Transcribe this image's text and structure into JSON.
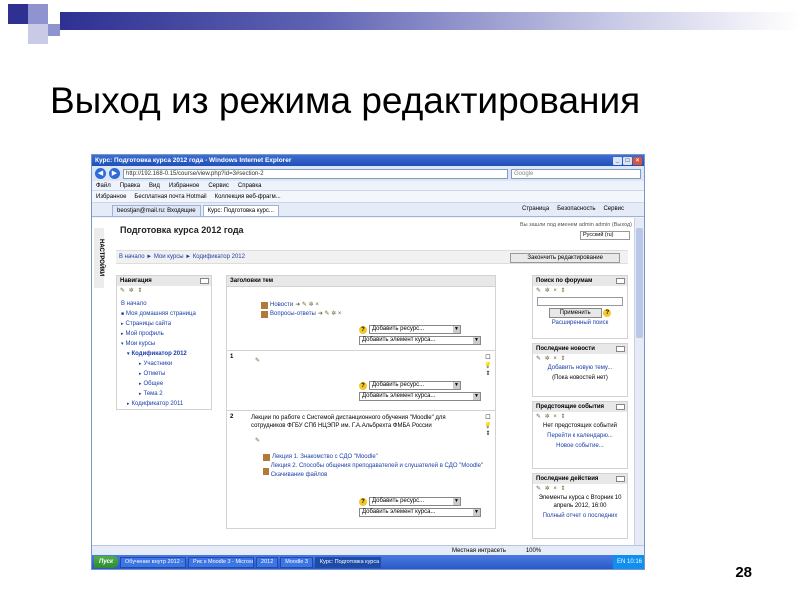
{
  "slide": {
    "title": "Выход из режима редактирования",
    "page_number": "28",
    "colors": {
      "bar_start": "#2e3192",
      "bar_end": "#ffffff"
    }
  },
  "browser": {
    "window_title": "Курс: Подготовка курса 2012 года - Windows Internet Explorer",
    "address": "http://192.168-0.15/course/view.php?id=3#section-2",
    "search_placeholder": "Google",
    "menu": [
      "Файл",
      "Правка",
      "Вид",
      "Избранное",
      "Сервис",
      "Справка"
    ],
    "favorites": [
      "Избранное",
      "Бесплатная почта Hotmail",
      "Коллекция веб-фрагм..."
    ],
    "tabs": [
      "beostjan@mail.ru: Входящие",
      "Курс: Подготовка курс..."
    ],
    "tab_tools": [
      "Страница",
      "Безопасность",
      "Сервис"
    ],
    "status_zone": "Местная интрасеть",
    "zoom": "100%"
  },
  "page": {
    "course_title": "Подготовка курса 2012 года",
    "logged_in": "Вы зашли под именем admin admin (Выход)",
    "language": "Русский (ru)",
    "breadcrumb": "В начало ► Мои курсы ► Кодификатор 2012",
    "edit_button": "Закончить редактирование",
    "left_strip": "НАСТРОЙКИ"
  },
  "navigation": {
    "title": "Навигация",
    "items": [
      {
        "label": "В начало",
        "level": 0
      },
      {
        "label": "Моя домашняя страница",
        "level": 0
      },
      {
        "label": "Страницы сайта",
        "level": 0
      },
      {
        "label": "Мой профиль",
        "level": 0
      },
      {
        "label": "Мои курсы",
        "level": 0
      },
      {
        "label": "Кодификатор 2012",
        "level": 1
      },
      {
        "label": "Участники",
        "level": 2
      },
      {
        "label": "Отметы",
        "level": 2
      },
      {
        "label": "Общее",
        "level": 2
      },
      {
        "label": "Тема 2",
        "level": 2
      },
      {
        "label": "Кодификатор 2011",
        "level": 1
      }
    ]
  },
  "sections": {
    "header": "Заголовки тем",
    "add_resource": "Добавить ресурс...",
    "add_activity": "Добавить элемент курса...",
    "section0_items": [
      "Новости",
      "Вопросы-ответы"
    ],
    "section1_num": "1",
    "section2_num": "2",
    "section2_text": "Лекции по работе с Системой дистанционного обучения \"Moodle\" для сотрудников ФГБУ СПб НЦЭПР им. Г.А.Альбрехта ФМБА России",
    "section2_items": [
      "Лекция 1. Знакомство с СДО \"Moodle\"",
      "Лекция 2. Способы общения преподавателей и слушателей в СДО \"Moodle\" Скачивание файлов"
    ]
  },
  "right_blocks": {
    "forum_search": "Поиск по форумам",
    "apply_button": "Применить",
    "advanced_search": "Расширенный поиск",
    "latest_news": "Последние новости",
    "add_topic": "Добавить новую тему...",
    "no_news": "(Пока новостей нет)",
    "upcoming": "Предстоящие события",
    "no_upcoming": "Нет предстоящих событий",
    "go_calendar": "Перейти к календарю...",
    "new_event": "Новое событие...",
    "recent": "Последние действия",
    "recent_since": "Элементы курса с Вторник 10 апрель 2012, 16:00",
    "full_report": "Полный отчет о последних"
  },
  "taskbar": {
    "start": "Пуск",
    "items": [
      "Обучение внутр 2012 - ...",
      "Рис к Moodle 3 - Microso...",
      "2012",
      "Moodle 3",
      "Курс: Подготовка курса ..."
    ],
    "lang": "EN",
    "clock": "10:16"
  }
}
